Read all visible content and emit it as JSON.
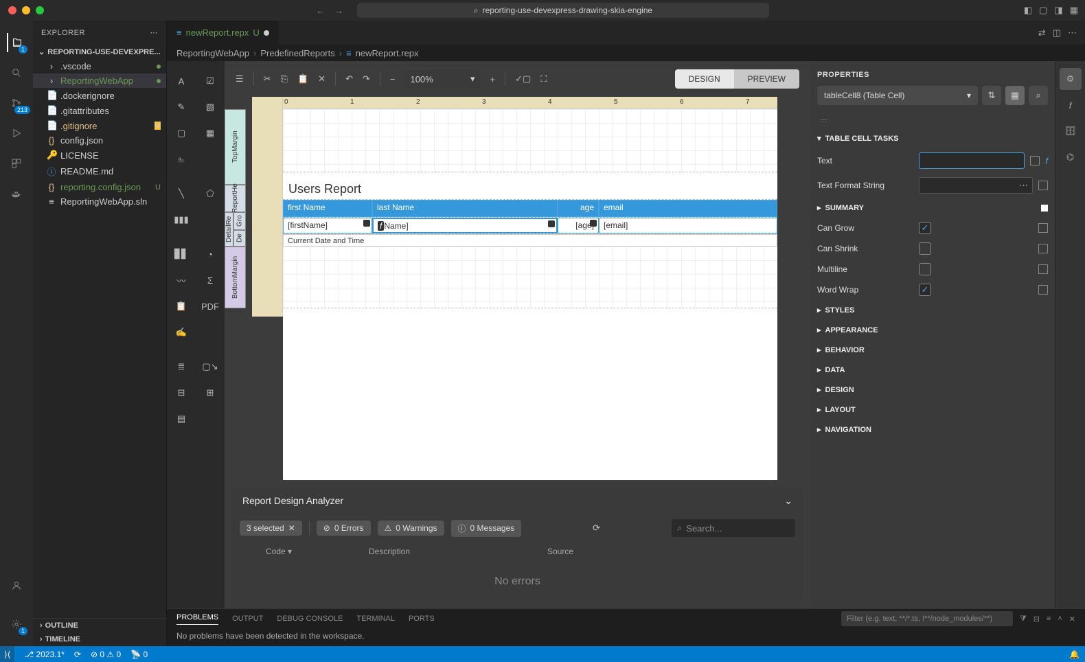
{
  "titlebar": {
    "search_text": "reporting-use-devexpress-drawing-skia-engine"
  },
  "activity": {
    "explorer_badge": "1",
    "scm_badge": "213"
  },
  "sidebar": {
    "title": "EXPLORER",
    "project": "REPORTING-USE-DEVEXPRE...",
    "items": [
      {
        "name": ".vscode",
        "kind": "folder",
        "status_dot": true
      },
      {
        "name": "ReportingWebApp",
        "kind": "folder",
        "selected": true,
        "green": true,
        "status_dot": true
      },
      {
        "name": ".dockerignore",
        "kind": "file"
      },
      {
        "name": ".gitattributes",
        "kind": "file"
      },
      {
        "name": ".gitignore",
        "kind": "file",
        "yellow": true,
        "status": "M"
      },
      {
        "name": "config.json",
        "kind": "file",
        "icon": "{}"
      },
      {
        "name": "LICENSE",
        "kind": "file",
        "icon": "🔑"
      },
      {
        "name": "README.md",
        "kind": "file",
        "icon": "ⓘ"
      },
      {
        "name": "reporting.config.json",
        "kind": "file",
        "icon": "{}",
        "green": true,
        "status": "U"
      },
      {
        "name": "ReportingWebApp.sln",
        "kind": "file"
      }
    ],
    "outline": "OUTLINE",
    "timeline": "TIMELINE"
  },
  "tabs": {
    "active": {
      "icon": "≡",
      "name": "newReport.repx",
      "status": "U"
    }
  },
  "breadcrumb": [
    "ReportingWebApp",
    "PredefinedReports",
    "newReport.repx"
  ],
  "designer": {
    "zoom": "100%",
    "design_btn": "DESIGN",
    "preview_btn": "PREVIEW",
    "bands": {
      "tm": "TopMargin",
      "rh": "ReportHe",
      "gro": "Gro",
      "det": "De",
      "dr": "DetailRe",
      "bm": "BottomMargin"
    },
    "report_title": "Users Report",
    "table": {
      "headers": [
        "first Name",
        "last Name",
        "age",
        "email"
      ],
      "cells": [
        "[firstName]",
        "Name]",
        "[age]",
        "[email]"
      ]
    },
    "footer": "Current Date and Time"
  },
  "analyzer": {
    "title": "Report Design Analyzer",
    "selected": "3 selected",
    "errors": "0 Errors",
    "warnings": "0 Warnings",
    "messages": "0 Messages",
    "search_placeholder": "Search...",
    "cols": {
      "code": "Code",
      "desc": "Description",
      "src": "Source"
    },
    "empty": "No errors"
  },
  "properties": {
    "title": "PROPERTIES",
    "selected_element": "tableCell8 (Table Cell)",
    "section1": "TABLE CELL TASKS",
    "rows": {
      "text": "Text",
      "format": "Text Format String",
      "summary": "SUMMARY",
      "can_grow": "Can Grow",
      "can_shrink": "Can Shrink",
      "multiline": "Multiline",
      "word_wrap": "Word Wrap"
    },
    "sections": [
      "STYLES",
      "APPEARANCE",
      "BEHAVIOR",
      "DATA",
      "DESIGN",
      "LAYOUT",
      "NAVIGATION"
    ]
  },
  "bottom": {
    "tabs": [
      "PROBLEMS",
      "OUTPUT",
      "DEBUG CONSOLE",
      "TERMINAL",
      "PORTS"
    ],
    "filter_placeholder": "Filter (e.g. text, **/*.ts, !**/node_modules/**)",
    "content": "No problems have been detected in the workspace."
  },
  "statusbar": {
    "branch": "2023.1*",
    "sync": "⟳",
    "errors": "0",
    "warnings": "0",
    "ports": "0"
  }
}
